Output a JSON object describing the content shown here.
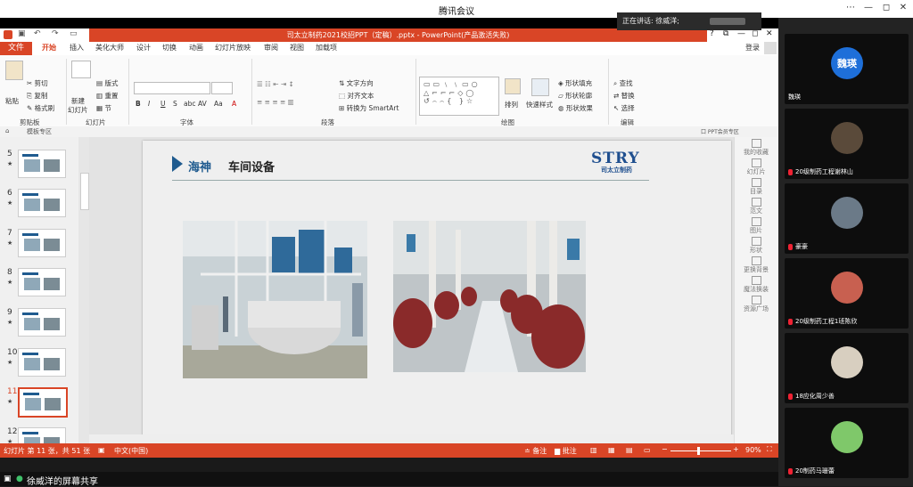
{
  "meeting": {
    "title": "腾讯会议",
    "speaker_label": "正在讲话: 徐威洋;",
    "share_label": "徐威洋的屏幕共享",
    "window_buttons": [
      "⋯",
      "—",
      "◻",
      "✕"
    ]
  },
  "ppt": {
    "window_title": "司太立制药2021校招PPT（定稿）.pptx - PowerPoint(产品激活失败)",
    "window_buttons": [
      "?",
      "⧉",
      "—",
      "◻",
      "✕"
    ],
    "tabs": [
      "文件",
      "开始",
      "插入",
      "美化大师",
      "设计",
      "切换",
      "动画",
      "幻灯片放映",
      "审阅",
      "视图",
      "加载项"
    ],
    "active_tab": "开始",
    "login": "登录",
    "ribbon": {
      "clipboard": {
        "paste": "粘贴",
        "cut": "剪切",
        "copy": "复制",
        "format_painter": "格式刷",
        "group": "剪贴板"
      },
      "slides": {
        "new_slide": "新建",
        "new_slide2": "幻灯片",
        "layout": "版式",
        "reset": "重置",
        "section": "节",
        "group": "幻灯片"
      },
      "font": {
        "group": "字体",
        "bold": "B",
        "italic": "I",
        "underline": "U",
        "strike": "S",
        "abc": "abc",
        "av": "AV",
        "aa": "Aa",
        "a": "A"
      },
      "paragraph": {
        "group": "段落",
        "text_direction": "文字方向",
        "align_text": "对齐文本",
        "smartart": "转换为 SmartArt"
      },
      "drawing": {
        "group": "绘图",
        "arrange": "排列",
        "quick_styles": "快速样式",
        "shape_fill": "形状填充",
        "shape_outline": "形状轮廓",
        "shape_effects": "形状效果"
      },
      "editing": {
        "group": "编辑",
        "find": "查找",
        "replace": "替换",
        "select": "选择"
      }
    },
    "quickbar_item": "模板专区",
    "quickbar_right": "口 PPT会员专区",
    "thumbnails": [
      {
        "num": "5"
      },
      {
        "num": "6"
      },
      {
        "num": "7"
      },
      {
        "num": "8"
      },
      {
        "num": "9"
      },
      {
        "num": "10"
      },
      {
        "num": "11"
      },
      {
        "num": "12"
      }
    ],
    "star": "★",
    "slide": {
      "title_part1": "海神",
      "title_part2": "车间设备",
      "logo": "STRY",
      "logo_sub": "司太立制药"
    },
    "side_panel": [
      "我的收藏",
      "幻灯片",
      "目录",
      "范文",
      "图片",
      "形状",
      "更换背景",
      "魔法换装",
      "资源广场"
    ],
    "status": {
      "slide_info": "幻灯片 第 11 张，共 51 张",
      "language": "中文(中国)",
      "notes": "备注",
      "comments": "批注",
      "zoom": "90%"
    }
  },
  "participants": [
    {
      "name": "魏瑛",
      "avatar_text": "魏瑛",
      "avatar_color": "#1e6fd9",
      "avatar_kind": "text"
    },
    {
      "name": "20级制药工程谢林山",
      "avatar_color": "#5a4a3a",
      "avatar_kind": "photo"
    },
    {
      "name": "豪豪",
      "avatar_color": "#6b7a88",
      "avatar_kind": "photo"
    },
    {
      "name": "20级制药工程1班陈欣",
      "avatar_color": "#c86050",
      "avatar_kind": "photo"
    },
    {
      "name": "18应化周少善",
      "avatar_color": "#d8cfc0",
      "avatar_kind": "photo"
    },
    {
      "name": "20制药马珊蕾",
      "avatar_color": "#7fc86a",
      "avatar_kind": "photo"
    }
  ]
}
